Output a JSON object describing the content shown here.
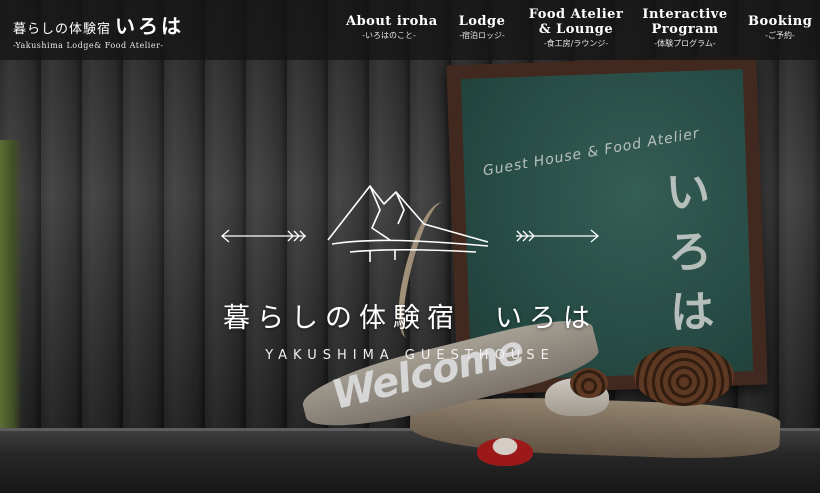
{
  "brand": {
    "title": "暮らしの体験宿",
    "title_kana": "いろは",
    "subtitle": "-Yakushima Lodge& Food Atelier-"
  },
  "nav": [
    {
      "label": "About iroha",
      "sub": "-いろはのこと-"
    },
    {
      "label": "Lodge",
      "sub": "-宿泊ロッジ-"
    },
    {
      "label": "Food Atelier\n& Lounge",
      "sub": "-食工房/ラウンジ-"
    },
    {
      "label": "Interactive\nProgram",
      "sub": "-体験プログラム-"
    },
    {
      "label": "Booking",
      "sub": "-ご予約-"
    }
  ],
  "hero": {
    "logo_title": "暮らしの体験宿　いろは",
    "logo_subtitle": "YAKUSHIMA GUESTHOUSE",
    "chalkboard_line": "Guest House & Food Atelier",
    "chalkboard_kana": "いろは",
    "welcome_sign": "Welcome"
  },
  "icons": {
    "mountain": "mountain-logo-icon",
    "arrow_left": "arrow-left-icon",
    "arrow_right": "arrow-right-icon"
  },
  "colors": {
    "header_bg": "#141414",
    "text": "#ffffff",
    "chalkboard": "#2e5750",
    "frame": "#4a2f24"
  }
}
